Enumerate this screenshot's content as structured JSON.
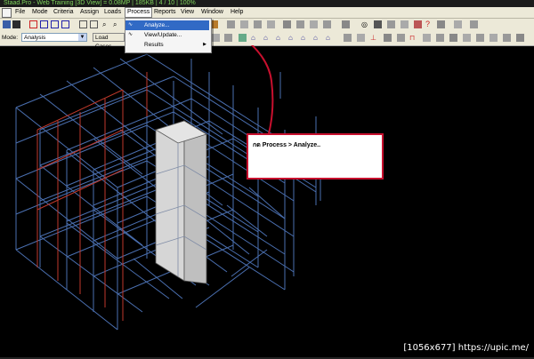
{
  "titlebar": {
    "text": "Staad.Pro - Web Training [3D View] = 0.08MP | 185KB | 4 / 10 | 100%"
  },
  "menu": {
    "items": [
      "File",
      "Mode",
      "Criteria",
      "Assign",
      "Loads",
      "Process",
      "Reports",
      "View",
      "Window",
      "Help"
    ],
    "active": "Process"
  },
  "process_menu": {
    "items": [
      {
        "label": "Analyze...",
        "icon": "analyze-icon",
        "highlighted": true,
        "submenu": false
      },
      {
        "label": "View/Update...",
        "icon": "view-update-icon",
        "highlighted": false,
        "submenu": false
      },
      {
        "label": "Results",
        "icon": "",
        "highlighted": false,
        "submenu": true
      }
    ]
  },
  "toolbar": {
    "mode_label": "Mode:",
    "mode_value": "Analysis",
    "load_cases_label": "Load Cases"
  },
  "callout": {
    "text": "กด Process > Analyze.."
  },
  "watermark": {
    "text": "[1056x677] https://upic.me/"
  },
  "colors": {
    "background": "#000000",
    "frame_blue": "#4a6fb0",
    "frame_red": "#c0392b",
    "callout_border": "#c8102e",
    "menu_bg": "#ece9d8",
    "highlight": "#316ac5"
  }
}
